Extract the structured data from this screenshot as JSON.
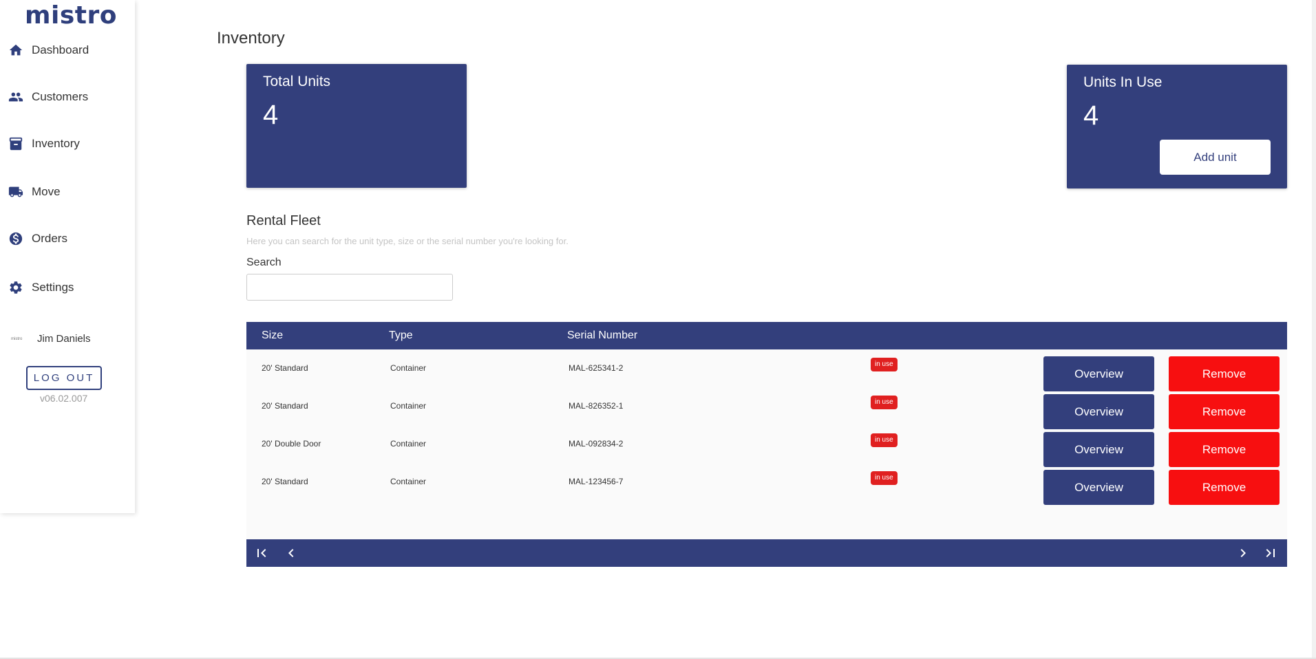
{
  "brand": {
    "logo_text": "mistro"
  },
  "sidebar": {
    "items": [
      {
        "label": "Dashboard",
        "icon": "home-icon"
      },
      {
        "label": "Customers",
        "icon": "people-icon"
      },
      {
        "label": "Inventory",
        "icon": "archive-icon"
      },
      {
        "label": "Move",
        "icon": "truck-icon"
      },
      {
        "label": "Orders",
        "icon": "dollar-icon"
      },
      {
        "label": "Settings",
        "icon": "gear-icon"
      }
    ],
    "user": {
      "mini_logo": "mistro",
      "name": "Jim Daniels"
    },
    "logout_label": "LOG OUT",
    "version": "v06.02.007"
  },
  "main": {
    "page_title": "Inventory",
    "total_units": {
      "title": "Total Units",
      "value": "4"
    },
    "units_in_use": {
      "title": "Units In Use",
      "value": "4",
      "add_button": "Add unit"
    },
    "fleet": {
      "title": "Rental Fleet",
      "description": "Here you can search for the unit type, size or the serial number you're looking for.",
      "search_label": "Search",
      "search_value": ""
    },
    "table": {
      "headers": [
        "Size",
        "Type",
        "Serial Number"
      ],
      "rows": [
        {
          "size": "20' Standard",
          "type": "Container",
          "serial": "MAL-625341-2",
          "status": "in use",
          "overview": "Overview",
          "remove": "Remove"
        },
        {
          "size": "20' Standard",
          "type": "Container",
          "serial": "MAL-826352-1",
          "status": "in use",
          "overview": "Overview",
          "remove": "Remove"
        },
        {
          "size": "20' Double Door",
          "type": "Container",
          "serial": "MAL-092834-2",
          "status": "in use",
          "overview": "Overview",
          "remove": "Remove"
        },
        {
          "size": "20' Standard",
          "type": "Container",
          "serial": "MAL-123456-7",
          "status": "in use",
          "overview": "Overview",
          "remove": "Remove"
        }
      ]
    },
    "pagination": {
      "first": "first-page-icon",
      "prev": "chevron-left-icon",
      "next": "chevron-right-icon",
      "last": "last-page-icon"
    }
  },
  "colors": {
    "primary": "#333f7c",
    "danger": "#f70f10",
    "badge": "#e02020"
  }
}
